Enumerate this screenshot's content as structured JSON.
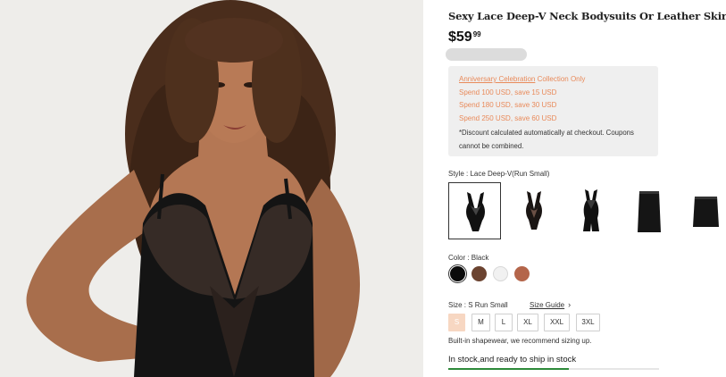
{
  "product": {
    "title": "Sexy Lace Deep-V Neck Bodysuits Or Leather Skirt",
    "price_main": "$59",
    "price_cents": "99"
  },
  "promo": {
    "highlight": "Anniversary Celebration",
    "headline_rest": " Collection Only",
    "tiers": [
      "Spend 100 USD, save 15 USD",
      "Spend 180 USD, save 30 USD",
      "Spend 250 USD, save 60 USD"
    ],
    "note": "*Discount calculated automatically at checkout. Coupons cannot be combined."
  },
  "style": {
    "label": "Style : Lace Deep-V(Run Small)",
    "options": [
      {
        "icon": "lace-bodysuit-icon",
        "selected": true
      },
      {
        "icon": "lace-bodysuit-icon",
        "selected": false
      },
      {
        "icon": "shorts-bodysuit-icon",
        "selected": false
      },
      {
        "icon": "leather-skirt-icon",
        "selected": false
      },
      {
        "icon": "leather-skirt-short-icon",
        "selected": false
      }
    ]
  },
  "color": {
    "label": "Color : Black",
    "swatches": [
      {
        "name": "black",
        "hex": "#0b0b0b",
        "selected": true
      },
      {
        "name": "brown",
        "hex": "#6b4330",
        "selected": false
      },
      {
        "name": "white",
        "hex": "#f1f1f1",
        "selected": false
      },
      {
        "name": "terracotta",
        "hex": "#b4654a",
        "selected": false
      }
    ]
  },
  "size": {
    "label": "Size : S Run Small",
    "guide_label": "Size Guide",
    "options": [
      "S",
      "M",
      "L",
      "XL",
      "XXL",
      "3XL"
    ],
    "selected": "S",
    "hint": "Built-in shapewear, we recommend sizing up."
  },
  "stock": {
    "text": "In stock,and ready to ship in stock",
    "level": 0.57,
    "bar_color": "#2e8a3a"
  }
}
